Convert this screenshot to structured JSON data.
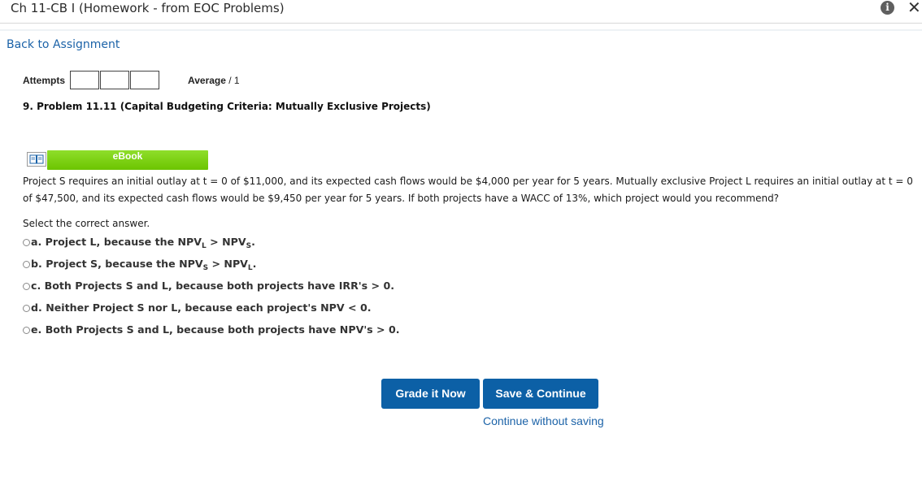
{
  "window": {
    "title": "Ch 11-CB I (Homework - from EOC Problems)",
    "info_icon": "i",
    "close_icon": "✕"
  },
  "nav": {
    "back_link": "Back to Assignment"
  },
  "attempts": {
    "label": "Attempts",
    "boxes": 3
  },
  "average": {
    "label": "Average",
    "value": "/ 1"
  },
  "problem": {
    "title": "9.  Problem 11.11 (Capital Budgeting Criteria: Mutually Exclusive Projects)"
  },
  "ebook": {
    "label": "eBook",
    "icon": "book-icon"
  },
  "question": {
    "text": "Project S requires an initial outlay at t = 0 of $11,000, and its expected cash flows would be $4,000 per year for 5 years. Mutually exclusive Project L requires an initial outlay at t = 0 of $47,500, and its expected cash flows would be $9,450 per year for 5 years. If both projects have a WACC of 13%, which project would you recommend?"
  },
  "answer_prompt": "Select the correct answer.",
  "options": [
    {
      "letter": "a.",
      "pre": " Project L, because the NPV",
      "sub1": "L",
      "mid": " > NPV",
      "sub2": "S",
      "post": "."
    },
    {
      "letter": "b.",
      "pre": " Project S, because the NPV",
      "sub1": "S",
      "mid": " > NPV",
      "sub2": "L",
      "post": "."
    },
    {
      "letter": "c.",
      "text": " Both Projects S and L, because both projects have IRR's > 0."
    },
    {
      "letter": "d.",
      "text": " Neither Project S nor L, because each project's NPV < 0."
    },
    {
      "letter": "e.",
      "text": " Both Projects S and L, because both projects have NPV's > 0."
    }
  ],
  "buttons": {
    "grade": "Grade it Now",
    "save": "Save & Continue",
    "continue_link": "Continue without saving"
  }
}
